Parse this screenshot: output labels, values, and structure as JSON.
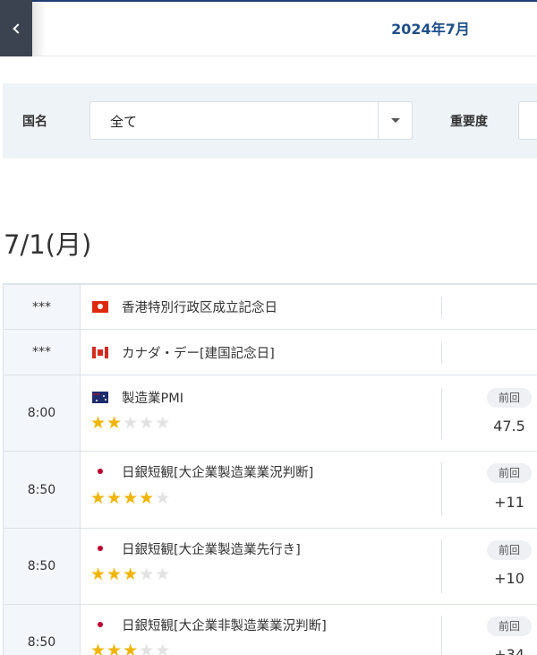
{
  "header": {
    "back_icon": "chevron-left-icon",
    "month_title": "2024年7月"
  },
  "filters": {
    "country_label": "国名",
    "country_value": "全て",
    "importance_label": "重要度"
  },
  "date_heading": "7/1(月)",
  "colors": {
    "star_on": "#f0b400",
    "star_off": "#e2e2e2",
    "time_cell_bg": "#f3f6fa",
    "header_accent": "#1f3f76"
  },
  "events": [
    {
      "time": "***",
      "country": "hong-kong-flag",
      "name": "香港特別行政区成立記念日"
    },
    {
      "time": "***",
      "country": "canada-flag",
      "name": "カナダ・デー[建国記念日]"
    },
    {
      "time": "8:00",
      "country": "australia-flag",
      "name": "製造業PMI",
      "stars": 2,
      "prev_label": "前回",
      "prev_value": "47.5"
    },
    {
      "time": "8:50",
      "country": "japan-flag",
      "name": "日銀短観[大企業製造業業況判断]",
      "stars": 4,
      "prev_label": "前回",
      "prev_value": "+11"
    },
    {
      "time": "8:50",
      "country": "japan-flag",
      "name": "日銀短観[大企業製造業先行き]",
      "stars": 3,
      "prev_label": "前回",
      "prev_value": "+10"
    },
    {
      "time": "8:50",
      "country": "japan-flag",
      "name": "日銀短観[大企業非製造業業況判断]",
      "stars": 3,
      "prev_label": "前回",
      "prev_value": "+34"
    }
  ]
}
